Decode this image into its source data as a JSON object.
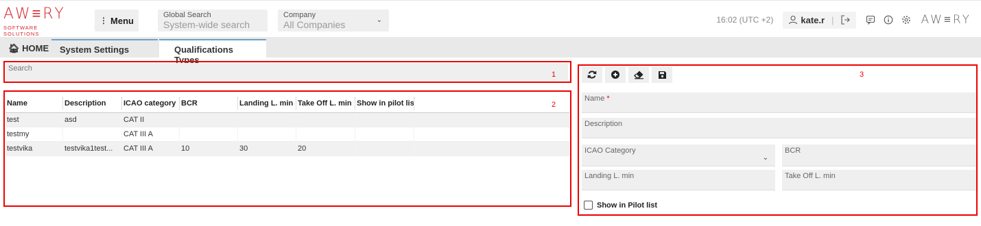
{
  "header": {
    "logo_word": "AW≡RY",
    "logo_sub": "SOFTWARE SOLUTIONS",
    "menu_label": "Menu",
    "global_search_label": "Global Search",
    "global_search_placeholder": "System-wide search",
    "company_label": "Company",
    "company_value": "All Companies",
    "time": "16:02 (UTC +2)",
    "user": "kate.r",
    "logo_small": "AW≡RY"
  },
  "tabs": [
    {
      "label": "HOME",
      "icon": "home-icon"
    },
    {
      "label": "System Settings"
    },
    {
      "label": "Qualifications Types"
    }
  ],
  "annotations": [
    "1",
    "2",
    "3"
  ],
  "search": {
    "label": "Search"
  },
  "table": {
    "columns": [
      "Name",
      "Description",
      "ICAO category",
      "BCR",
      "Landing L. min",
      "Take Off L. min",
      "Show in pilot list"
    ],
    "rows": [
      [
        "test",
        "asd",
        "CAT II",
        "",
        "",
        "",
        ""
      ],
      [
        "testmy",
        "",
        "CAT III A",
        "",
        "",
        "",
        ""
      ],
      [
        "testvika",
        "testvika1test...",
        "CAT III A",
        "10",
        "30",
        "20",
        ""
      ]
    ]
  },
  "form": {
    "toolbar": [
      "refresh-icon",
      "add-icon",
      "erase-icon",
      "save-icon"
    ],
    "name_label": "Name",
    "required_mark": "*",
    "description_label": "Description",
    "icao_label": "ICAO Category",
    "bcr_label": "BCR",
    "landing_label": "Landing L. min",
    "takeoff_label": "Take Off L. min",
    "pilot_label": "Show in Pilot list"
  },
  "colors": {
    "brand": "#d6232a",
    "annotation": "#ee0000",
    "tab_accent": "#6aa0c8"
  }
}
